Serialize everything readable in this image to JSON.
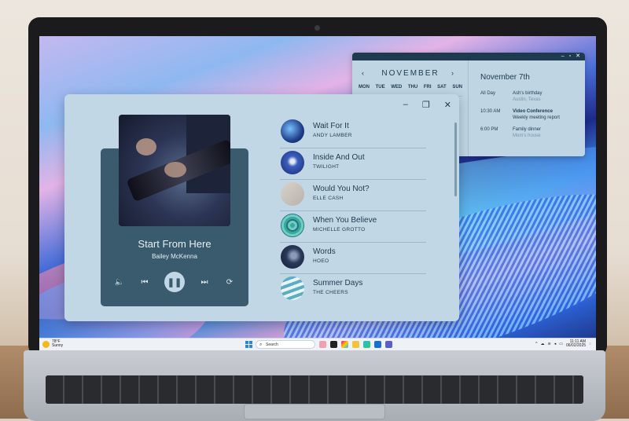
{
  "calendar": {
    "month": "NOVEMBER",
    "prev": "‹",
    "next": "›",
    "weekdays": [
      "MON",
      "TUE",
      "WED",
      "THU",
      "FRI",
      "SAT",
      "SUN"
    ],
    "date": "November 7th",
    "events": [
      {
        "time": "All Day",
        "name": "Ash's birthday",
        "sub": "Austin, Texas"
      },
      {
        "time": "10:30 AM",
        "name": "Video Conference",
        "sub": "Weekly meeting report"
      },
      {
        "time": "6:00 PM",
        "name": "Family dinner",
        "sub": "Mom's house"
      }
    ],
    "controls": [
      "–",
      "▫",
      "✕"
    ]
  },
  "player": {
    "window_controls": {
      "minimize": "–",
      "maximize": "❐",
      "close": "✕"
    },
    "now_playing": {
      "title": "Start From Here",
      "artist": "Bailey McKenna"
    },
    "controls": {
      "volume": "🔈",
      "prev": "⏮",
      "pause": "❚❚",
      "next": "⏭",
      "repeat": "⟳"
    },
    "playlist": [
      {
        "title": "Wait For It",
        "artist": "ANDY LAMBER"
      },
      {
        "title": "Inside And Out",
        "artist": "TWILIGHT"
      },
      {
        "title": "Would You Not?",
        "artist": "ELLE CASH"
      },
      {
        "title": "When You Believe",
        "artist": "MICHELLE GROTTO"
      },
      {
        "title": "Words",
        "artist": "HOEO"
      },
      {
        "title": "Summer Days",
        "artist": "THE CHEERS"
      }
    ]
  },
  "taskbar": {
    "weather_temp": "78°F",
    "weather_desc": "Sunny",
    "search_placeholder": "Search",
    "time": "11:11 AM",
    "date": "06/02/2025"
  },
  "colors": {
    "panel": "#c2d7e6",
    "card": "#3a5a6e",
    "text_dark": "#1e3a4e",
    "thumb_colors": [
      "#1f3f8a",
      "#2c4fa0",
      "#c8c2bc",
      "#3aa89a",
      "#2a3a5a",
      "#5aaec0"
    ]
  }
}
